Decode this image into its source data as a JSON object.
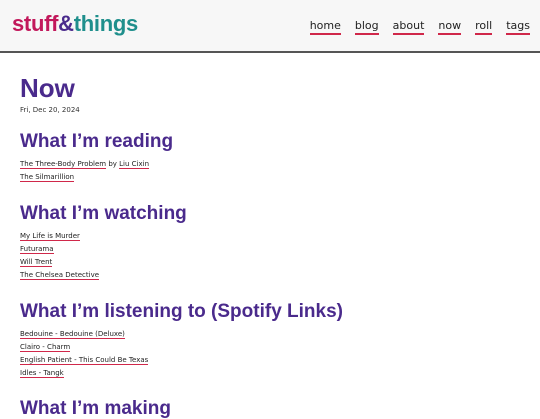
{
  "site": {
    "logo_part1": "stuff",
    "logo_amp": "&",
    "logo_part2": "things"
  },
  "nav": [
    {
      "label": "home"
    },
    {
      "label": "blog"
    },
    {
      "label": "about"
    },
    {
      "label": "now"
    },
    {
      "label": "roll"
    },
    {
      "label": "tags"
    }
  ],
  "page": {
    "title": "Now",
    "date": "Fri, Dec 20, 2024"
  },
  "reading": {
    "heading": "What I’m reading",
    "items": [
      {
        "title": "The Three-Body Problem",
        "by": "by",
        "author": "Liu Cixin"
      },
      {
        "title": "The Silmarillion"
      }
    ]
  },
  "watching": {
    "heading": "What I’m watching",
    "items": [
      "My Life is Murder",
      "Futurama",
      "Will Trent",
      "The Chelsea Detective"
    ]
  },
  "listening": {
    "heading": "What I’m listening to (Spotify Links)",
    "items": [
      "Bedouine - Bedouine (Deluxe)",
      "Clairo - Charm",
      "English Patient - This Could Be Texas",
      "Idles - Tangk"
    ]
  },
  "next_section": {
    "heading": "What I’m making"
  },
  "colors": {
    "accent_purple": "#4a2a8c",
    "underline_red": "#d0284a",
    "logo_pink": "#c2185b",
    "logo_teal": "#1f8f8c"
  }
}
